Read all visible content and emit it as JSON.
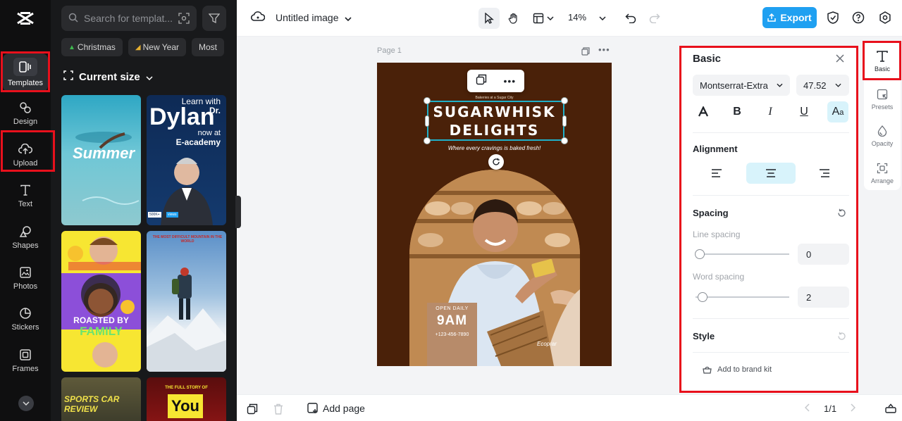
{
  "rail": {
    "items": [
      {
        "label": "Templates",
        "icon": "templates-icon"
      },
      {
        "label": "Design",
        "icon": "design-icon"
      },
      {
        "label": "Upload",
        "icon": "upload-icon"
      },
      {
        "label": "Text",
        "icon": "text-icon"
      },
      {
        "label": "Shapes",
        "icon": "shapes-icon"
      },
      {
        "label": "Photos",
        "icon": "photos-icon"
      },
      {
        "label": "Stickers",
        "icon": "stickers-icon"
      },
      {
        "label": "Frames",
        "icon": "frames-icon"
      }
    ]
  },
  "panel": {
    "search_placeholder": "Search for templat...",
    "chips": [
      "Christmas",
      "New Year",
      "Most"
    ],
    "size_label": "Current size",
    "thumbs": {
      "summer": "Summer",
      "dylan_top": "Learn with",
      "dylan_dr": "Dr.",
      "dylan_name": "Dylan",
      "dylan_now": "now at",
      "dylan_academy": "E-academy",
      "dylan_views": "500K+",
      "dylan_views2": "views",
      "roasted": "ROASTED BY",
      "family": "FAMILY",
      "mountain": "THE MOST DIFFICULT MOUNTAIN IN THE WORLD",
      "sports": "SPORTS CAR REVIEW",
      "fullstory": "THE FULL STORY OF",
      "you": "You"
    }
  },
  "topbar": {
    "title": "Untitled image",
    "zoom": "14%",
    "export_label": "Export"
  },
  "canvas": {
    "page_label": "Page 1",
    "poster": {
      "tiny_top": "Bakeries at a Sugar City",
      "title_line1": "SUGARWHISK",
      "title_line2": "DELIGHTS",
      "tagline": "Where every cravings is baked fresh!",
      "open_label": "OPEN DAILY",
      "time": "9AM",
      "phone": "+123-456-7890",
      "brand": "Ecoprar"
    }
  },
  "bottombar": {
    "add_page": "Add page",
    "pager": "1/1"
  },
  "props": {
    "title": "Basic",
    "font": "Montserrat-Extra",
    "size": "47.52",
    "alignment_label": "Alignment",
    "spacing_label": "Spacing",
    "line_spacing_label": "Line spacing",
    "line_spacing_value": "0",
    "word_spacing_label": "Word spacing",
    "word_spacing_value": "2",
    "style_label": "Style",
    "brand_kit": "Add to brand kit"
  },
  "tabs": [
    {
      "label": "Basic",
      "icon": "text-t-icon"
    },
    {
      "label": "Presets",
      "icon": "presets-icon"
    },
    {
      "label": "Opacity",
      "icon": "opacity-icon"
    },
    {
      "label": "Arrange",
      "icon": "arrange-icon"
    }
  ],
  "colors": {
    "accent": "#1fa0f1",
    "highlight": "#e8101c",
    "poster_bg": "#4a2109"
  }
}
